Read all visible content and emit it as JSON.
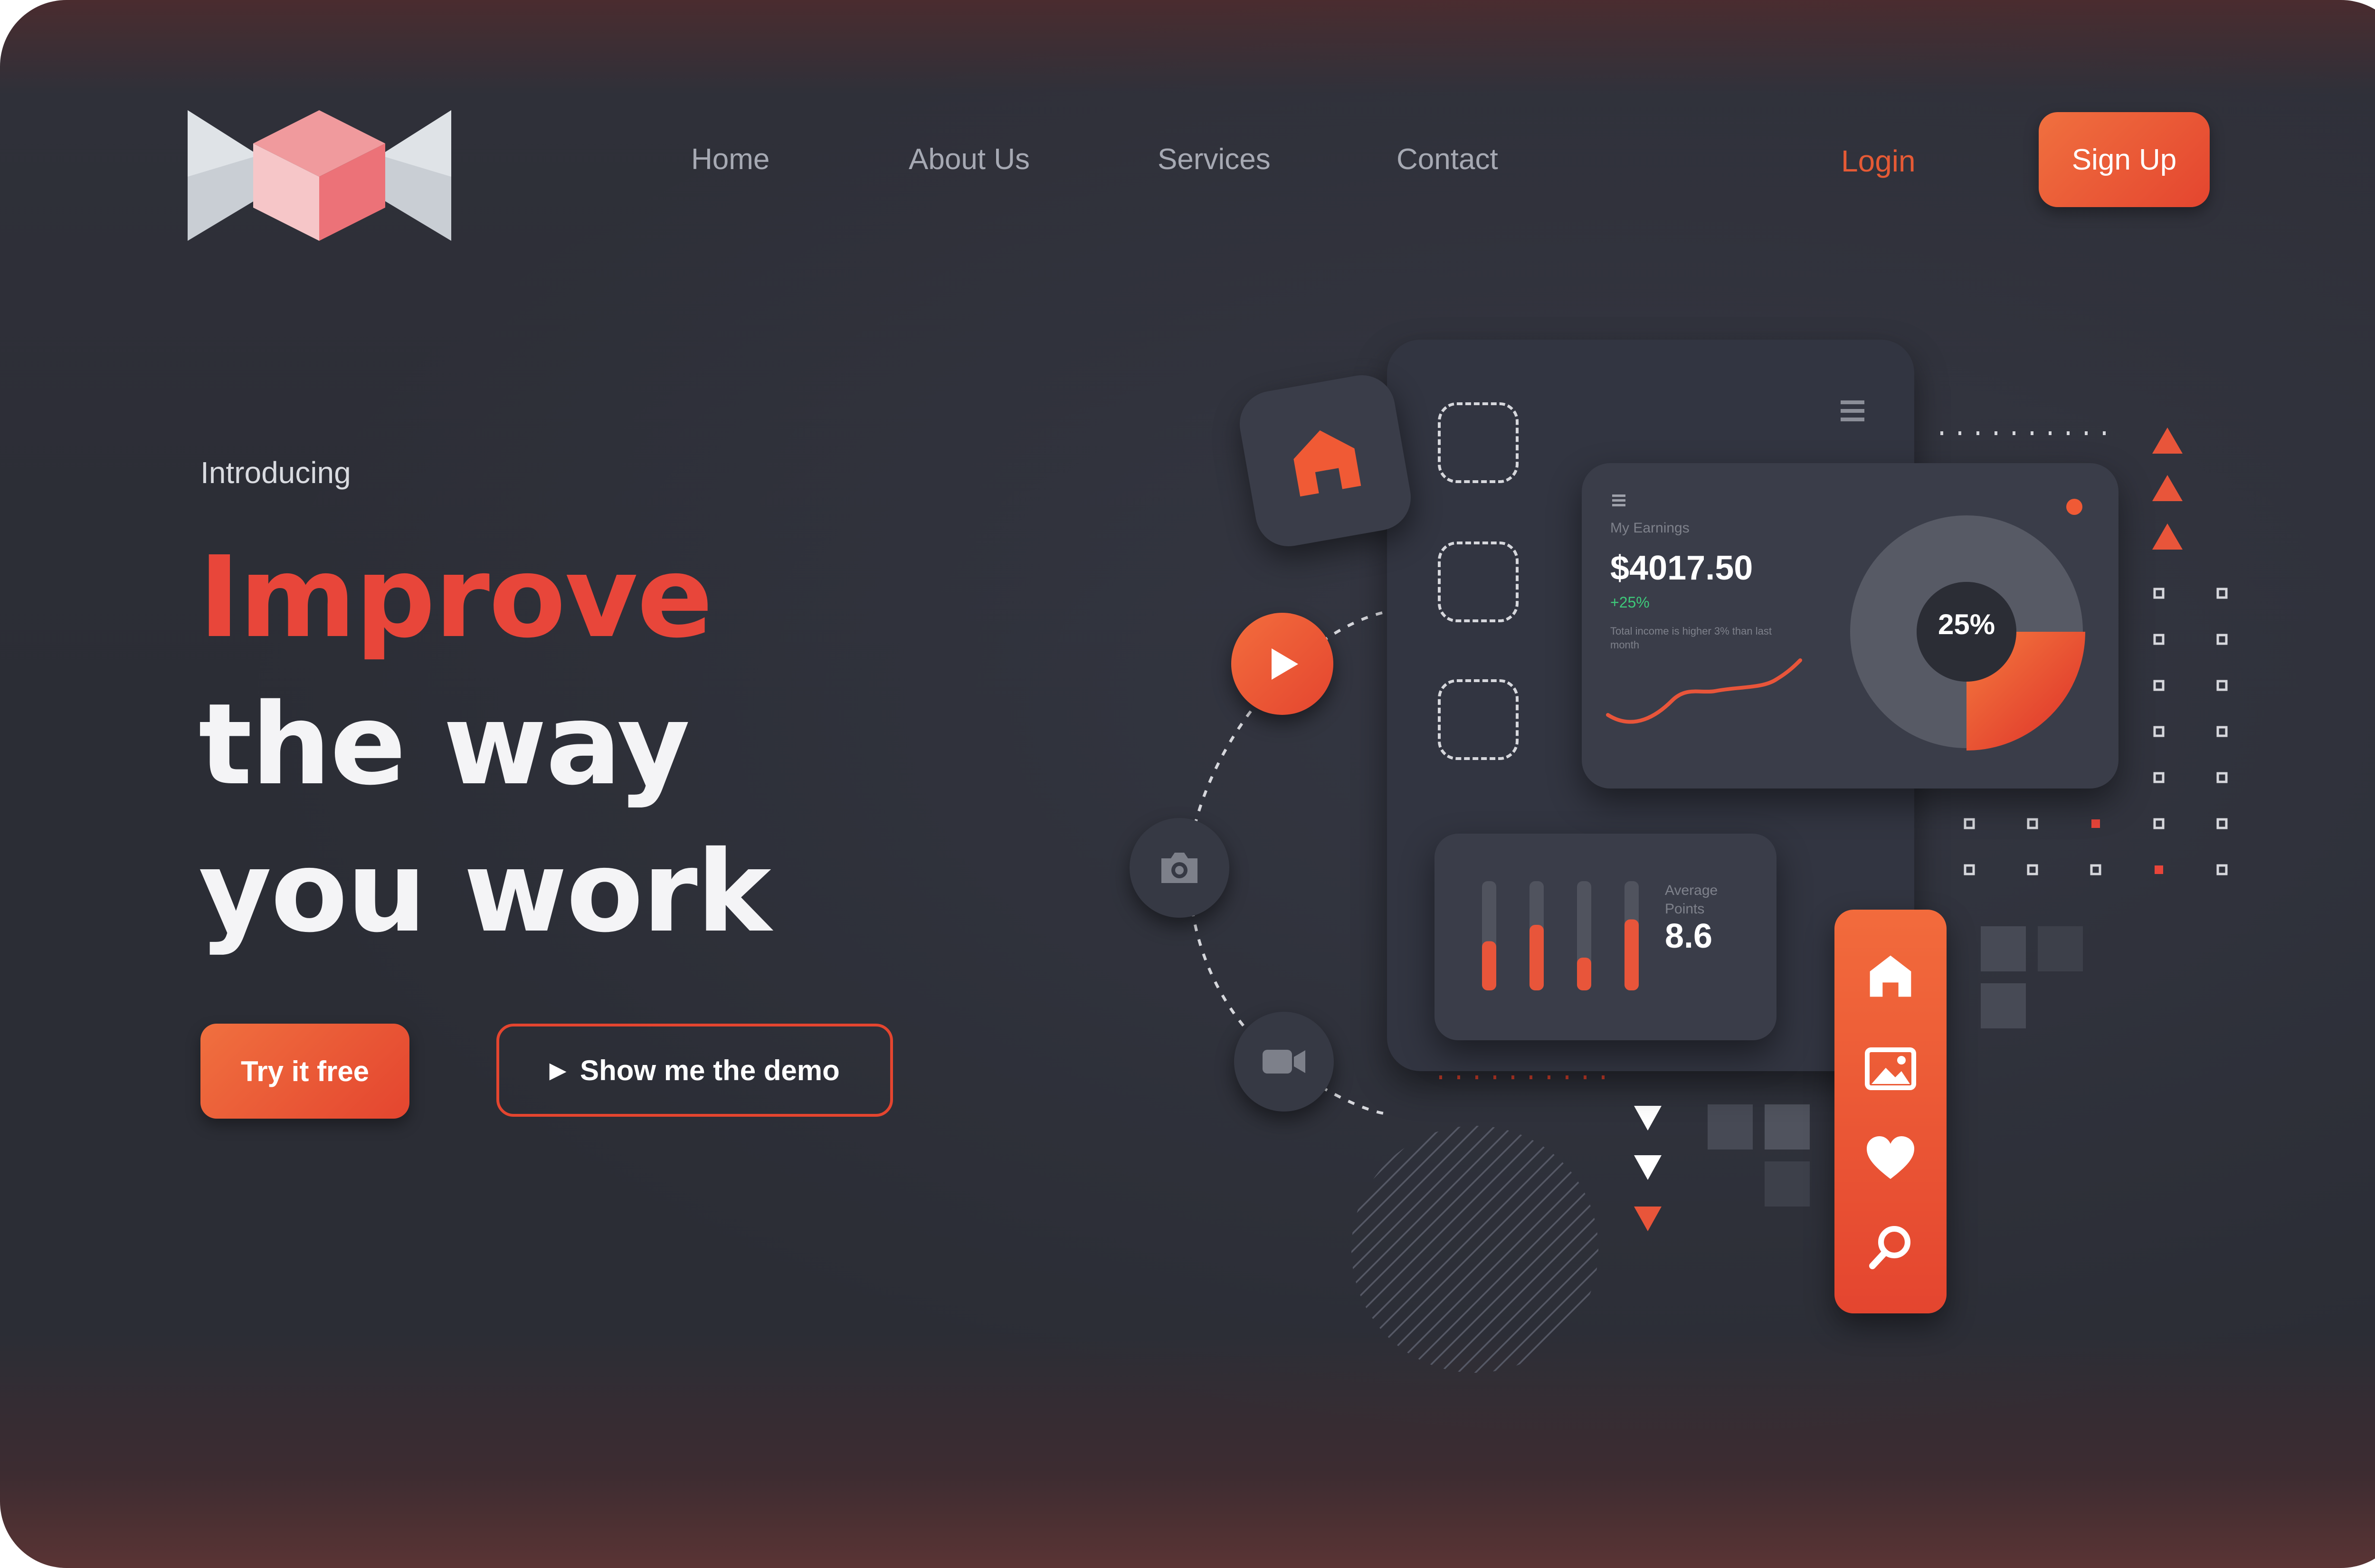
{
  "nav": {
    "links": [
      "Home",
      "About Us",
      "Services",
      "Contact"
    ],
    "login": "Login",
    "signup": "Sign Up"
  },
  "hero": {
    "intro": "Introducing",
    "headline_accent": "Improve",
    "headline_line2": "the way",
    "headline_line3": "you work",
    "try_button": "Try it free",
    "demo_button": "Show me the demo"
  },
  "illustration": {
    "earnings_label": "My Earnings",
    "earnings_value": "$4017.50",
    "earnings_change": "+25%",
    "earnings_note": "Total income is higher 3% than last month",
    "donut_percent": "25%",
    "donut_fraction": 0.25,
    "avg_label": "Average Points",
    "avg_value": "8.6",
    "bar_levels": [
      0.45,
      0.6,
      0.3,
      0.65
    ]
  },
  "colors": {
    "accent": "#e4452f",
    "accent_light": "#f0703f",
    "background": "#2b2d35",
    "card": "#3a3d49"
  }
}
